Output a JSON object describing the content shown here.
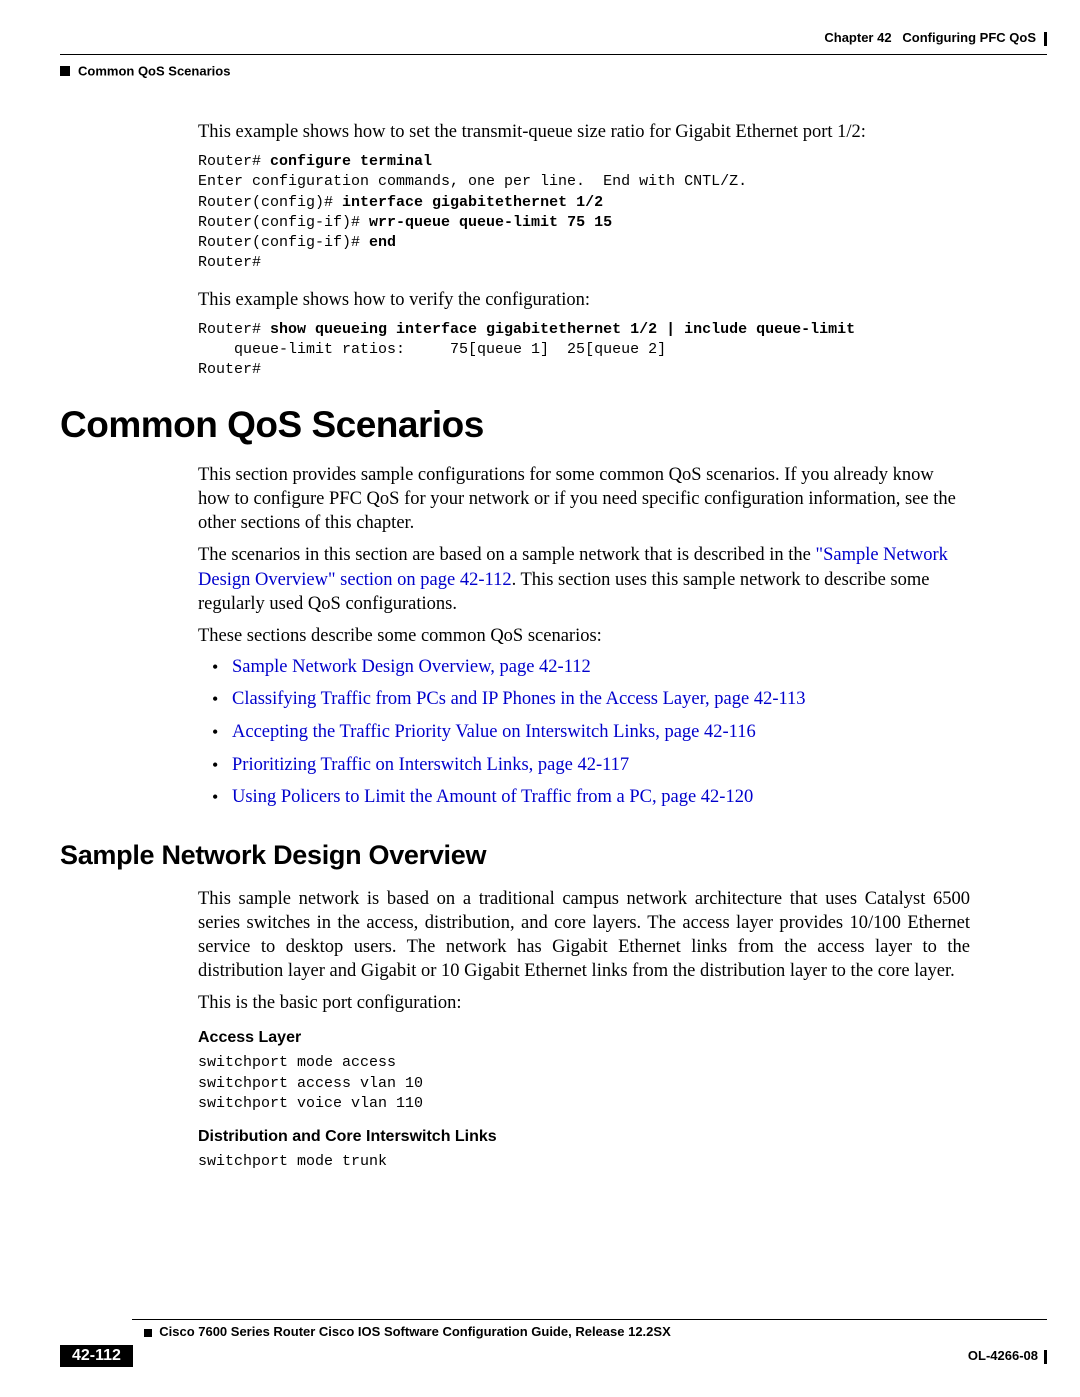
{
  "header": {
    "chapter": "Chapter 42",
    "title": "Configuring PFC QoS"
  },
  "breadcrumb": "Common QoS Scenarios",
  "intro1": "This example shows how to set the transmit-queue size ratio for Gigabit Ethernet port 1/2:",
  "code1": {
    "l1a": "Router# ",
    "l1b": "configure terminal",
    "l2": "Enter configuration commands, one per line.  End with CNTL/Z.",
    "l3a": "Router(config)# ",
    "l3b": "interface gigabitethernet 1/2",
    "l4a": "Router(config-if)# ",
    "l4b": "wrr-queue queue-limit 75 15",
    "l5a": "Router(config-if)# ",
    "l5b": "end",
    "l6": "Router#"
  },
  "intro2": "This example shows how to verify the configuration:",
  "code2": {
    "l1a": "Router# ",
    "l1b": "show queueing interface gigabitethernet 1/2 | include queue-limit",
    "l2": "    queue-limit ratios:     75[queue 1]  25[queue 2]",
    "l3": "Router#"
  },
  "h1": "Common QoS Scenarios",
  "p1": "This section provides sample configurations for some common QoS scenarios. If you already know how to configure PFC QoS for your network or if you need specific configuration information, see the other sections of this chapter.",
  "p2a": "The scenarios in this section are based on a sample network that is described in the ",
  "p2link": "\"Sample Network Design Overview\" section on page 42-112",
  "p2b": ". This section uses this sample network to describe some regularly used QoS configurations.",
  "p3": "These sections describe some common QoS scenarios:",
  "bullets": [
    "Sample Network Design Overview, page 42-112",
    "Classifying Traffic from PCs and IP Phones in the Access Layer, page 42-113",
    "Accepting the Traffic Priority Value on Interswitch Links, page 42-116",
    "Prioritizing Traffic on Interswitch Links, page 42-117",
    "Using Policers to Limit the Amount of Traffic from a PC, page 42-120"
  ],
  "h2": "Sample Network Design Overview",
  "p4": "This sample network is based on a traditional campus network architecture that uses Catalyst 6500 series switches in the access, distribution, and core layers. The access layer provides 10/100 Ethernet service to desktop users. The network has Gigabit Ethernet links from the access layer to the distribution layer and Gigabit or 10 Gigabit Ethernet links from the distribution layer to the core layer.",
  "p5": "This is the basic port configuration:",
  "sub1": "Access Layer",
  "code3": "switchport mode access\nswitchport access vlan 10\nswitchport voice vlan 110",
  "sub2": "Distribution and Core Interswitch Links",
  "code4": "switchport mode trunk",
  "footer": {
    "guide": "Cisco 7600 Series Router Cisco IOS Software Configuration Guide, Release 12.2SX",
    "page": "42-112",
    "pubnum": "OL-4266-08"
  }
}
